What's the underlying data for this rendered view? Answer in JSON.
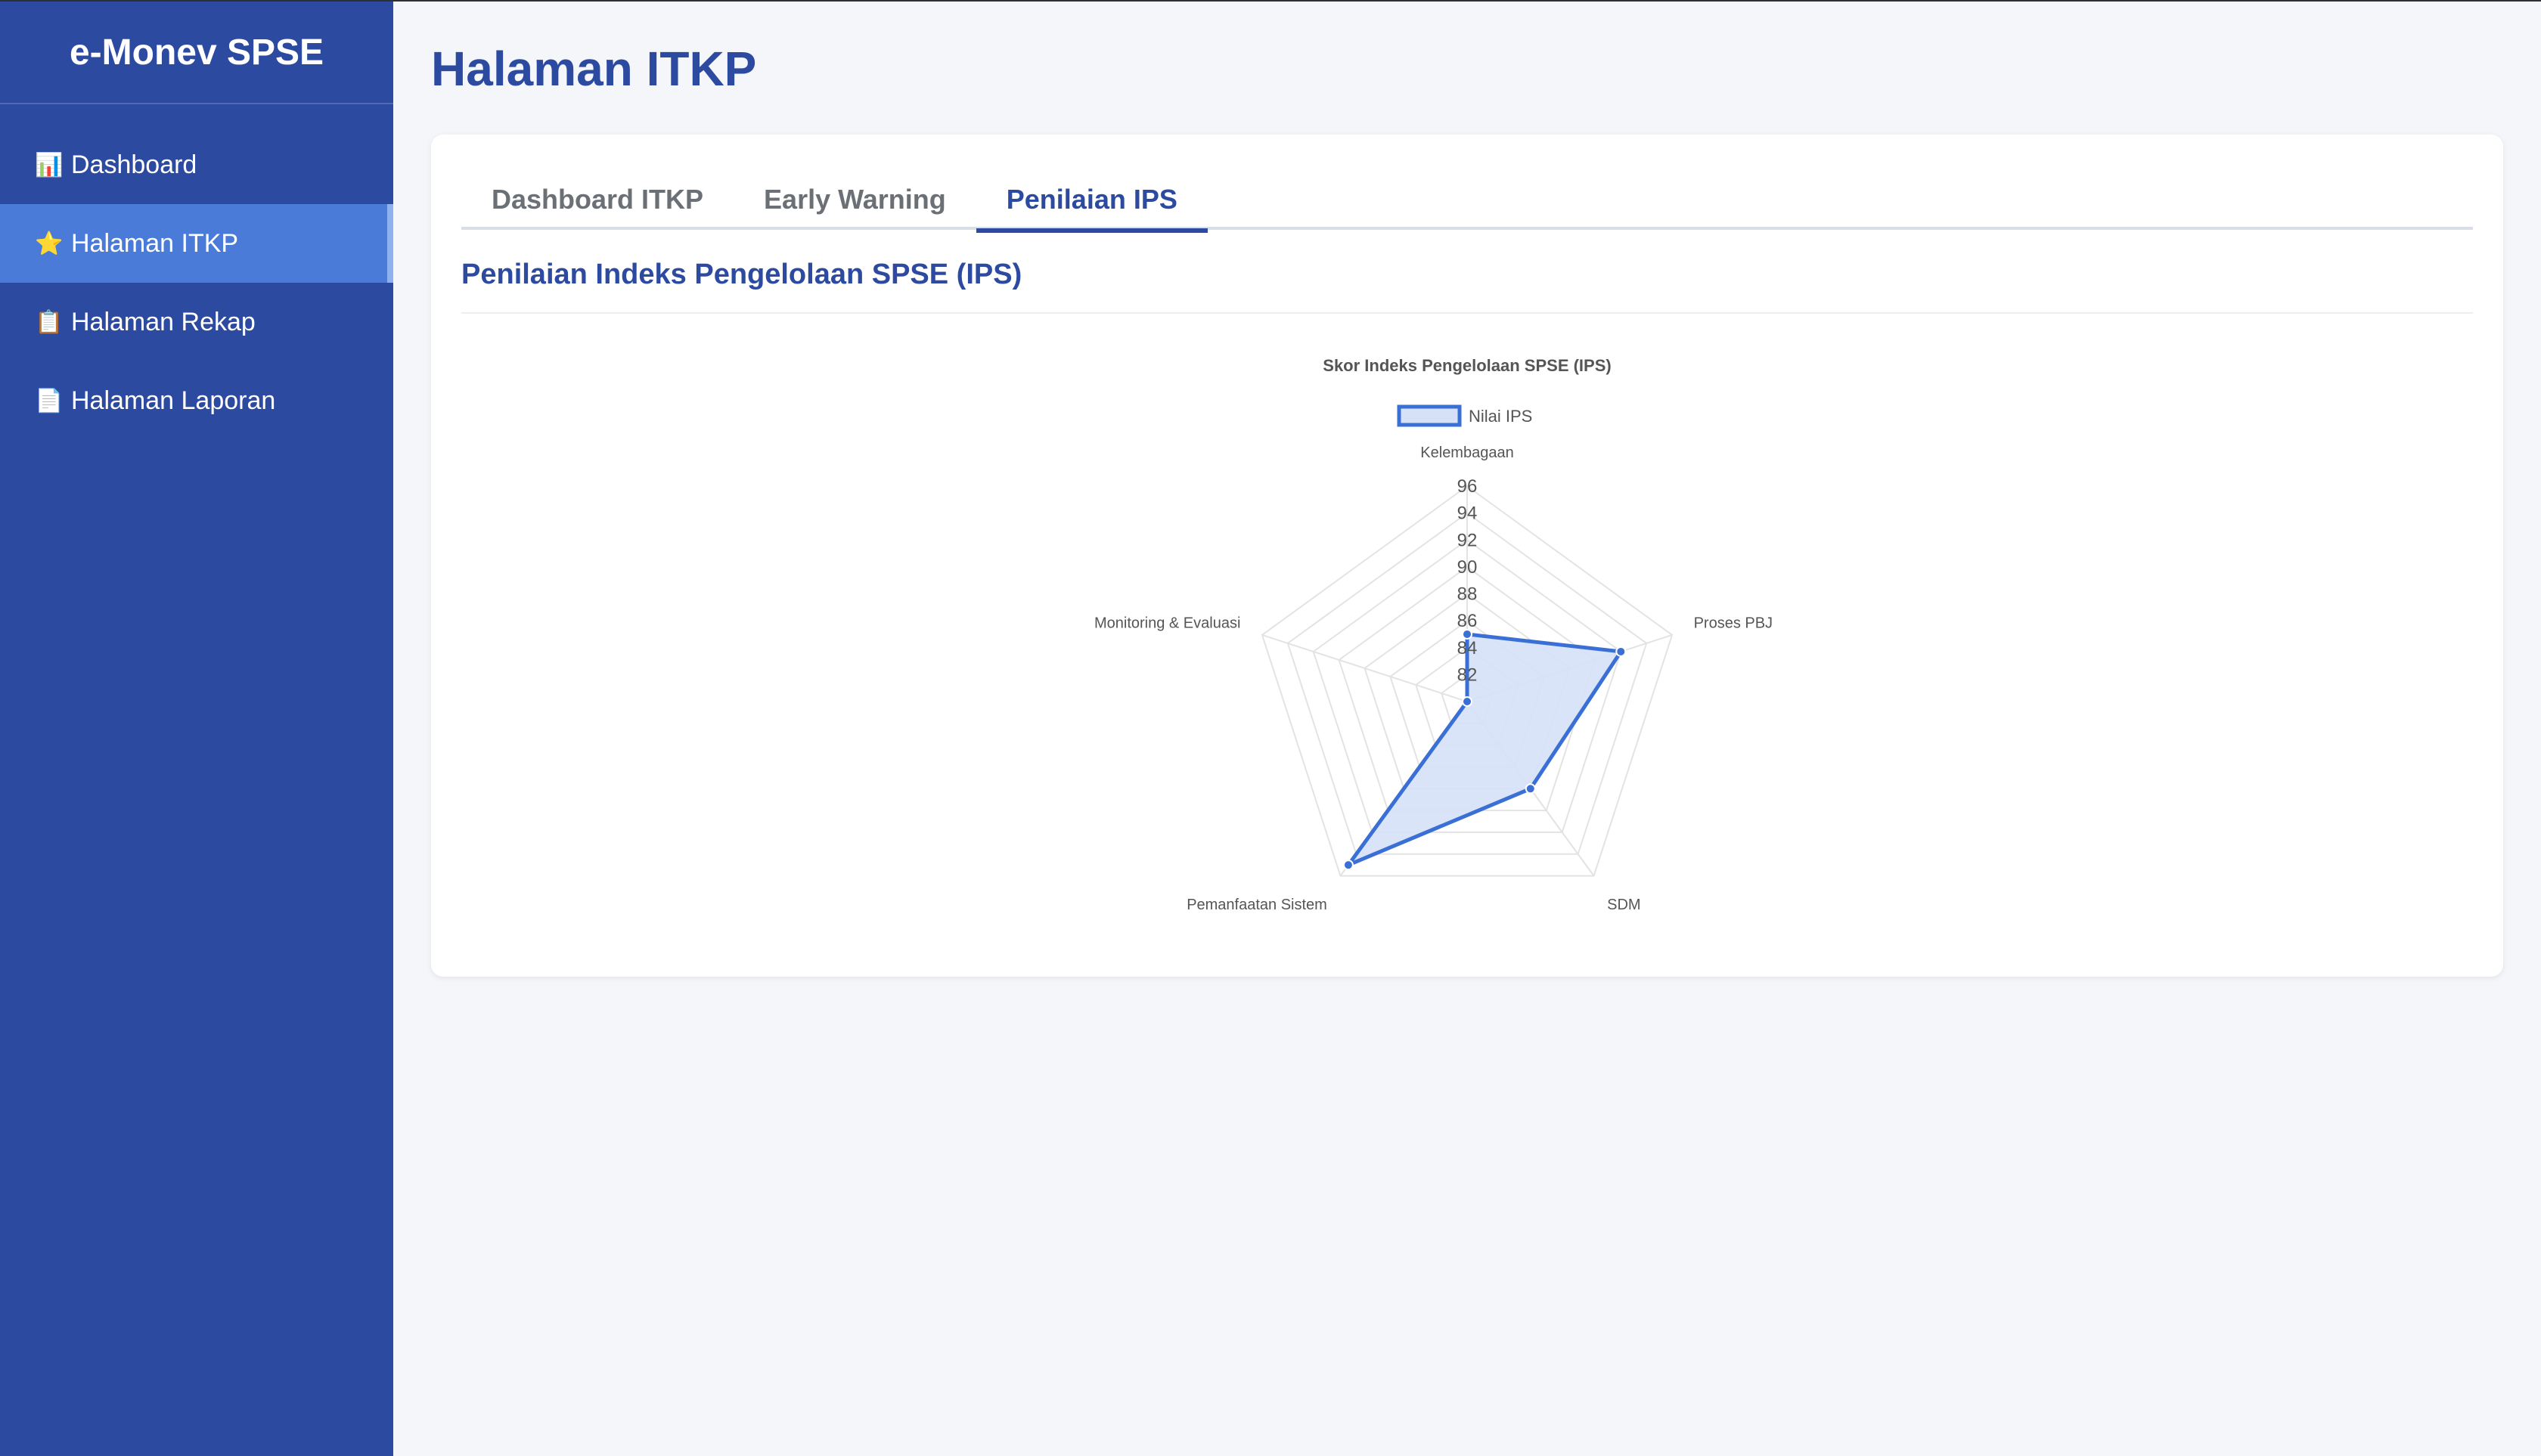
{
  "app": {
    "brand": "e-Monev SPSE"
  },
  "sidebar": {
    "items": [
      {
        "label": "Dashboard",
        "icon": "bar-chart-icon",
        "glyph": "📊",
        "active": false
      },
      {
        "label": "Halaman ITKP",
        "icon": "star-icon",
        "glyph": "⭐",
        "active": true
      },
      {
        "label": "Halaman Rekap",
        "icon": "clipboard-icon",
        "glyph": "📋",
        "active": false
      },
      {
        "label": "Halaman Laporan",
        "icon": "document-icon",
        "glyph": "📄",
        "active": false
      }
    ]
  },
  "page": {
    "title": "Halaman ITKP"
  },
  "tabs": [
    {
      "label": "Dashboard ITKP",
      "active": false
    },
    {
      "label": "Early Warning",
      "active": false
    },
    {
      "label": "Penilaian IPS",
      "active": true
    }
  ],
  "section": {
    "title": "Penilaian Indeks Pengelolaan SPSE (IPS)"
  },
  "colors": {
    "sidebar": "#2c4aa0",
    "accent": "#2c4aa0",
    "series": "#3a6fd6",
    "series_fill": "#d6e1f7"
  },
  "chart_data": {
    "type": "radar",
    "title": "Skor Indeks Pengelolaan SPSE (IPS)",
    "axes": [
      "Kelembagaan",
      "Proses PBJ",
      "SDM",
      "Pemanfaatan Sistem",
      "Monitoring & Evaluasi"
    ],
    "r_range": [
      80,
      96
    ],
    "ticks": [
      "82",
      "84",
      "86",
      "88",
      "90",
      "92",
      "94",
      "96"
    ],
    "series": [
      {
        "name": "Nilai IPS",
        "values": [
          85,
          92,
          88,
          95,
          80
        ]
      }
    ],
    "legend": "top",
    "grid": true
  }
}
